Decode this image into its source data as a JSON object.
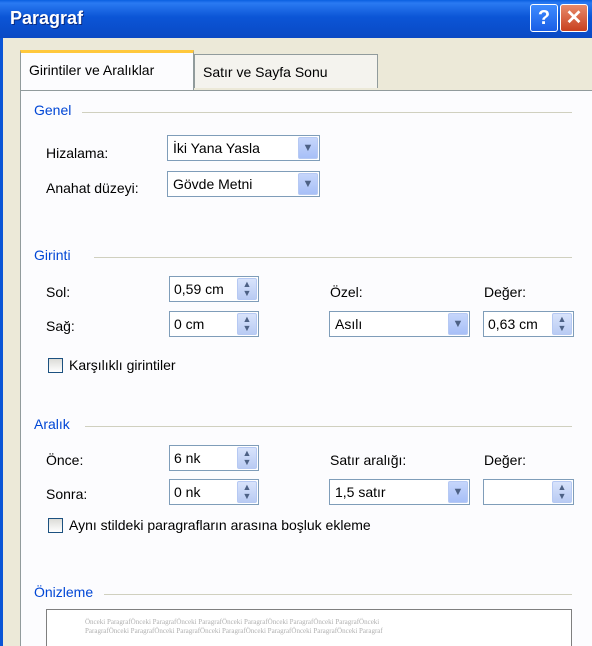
{
  "window": {
    "title": "Paragraf",
    "help_glyph": "?",
    "close_glyph": "✕"
  },
  "tabs": [
    {
      "label": "Girintiler ve Aralıklar",
      "active": true
    },
    {
      "label": "Satır ve Sayfa Sonu",
      "active": false
    }
  ],
  "genel": {
    "title": "Genel",
    "alignment_label": "Hizalama:",
    "alignment_value": "İki Yana Yasla",
    "outline_label": "Anahat düzeyi:",
    "outline_value": "Gövde Metni"
  },
  "girinti": {
    "title": "Girinti",
    "left_label": "Sol:",
    "left_value": "0,59 cm",
    "right_label": "Sağ:",
    "right_value": "0 cm",
    "special_label": "Özel:",
    "special_value": "Asılı",
    "by_label": "Değer:",
    "by_value": "0,63 cm",
    "mirror_label": "Karşılıklı girintiler",
    "mirror_checked": false
  },
  "aralik": {
    "title": "Aralık",
    "before_label": "Önce:",
    "before_value": "6 nk",
    "after_label": "Sonra:",
    "after_value": "0 nk",
    "line_spacing_label": "Satır aralığı:",
    "line_spacing_value": "1,5 satır",
    "at_label": "Değer:",
    "at_value": "",
    "no_space_label": "Aynı stildeki paragrafların arasına boşluk ekleme",
    "no_space_checked": false
  },
  "onizleme": {
    "title": "Önizleme",
    "preview_line1": "Önceki ParagrafÖnceki ParagrafÖnceki ParagrafÖnceki ParagrafÖnceki ParagrafÖnceki ParagrafÖnceki",
    "preview_line2": "ParagrafÖnceki ParagrafÖnceki ParagrafÖnceki ParagrafÖnceki ParagrafÖnceki ParagrafÖnceki Paragraf"
  },
  "icons": {
    "dropdown": "chevron-down-icon",
    "spinner": "spin-up-down-icon"
  },
  "colors": {
    "titlebar": "#0a55d6",
    "group_title": "#0046d5",
    "tab_highlight": "#ffc83c"
  }
}
